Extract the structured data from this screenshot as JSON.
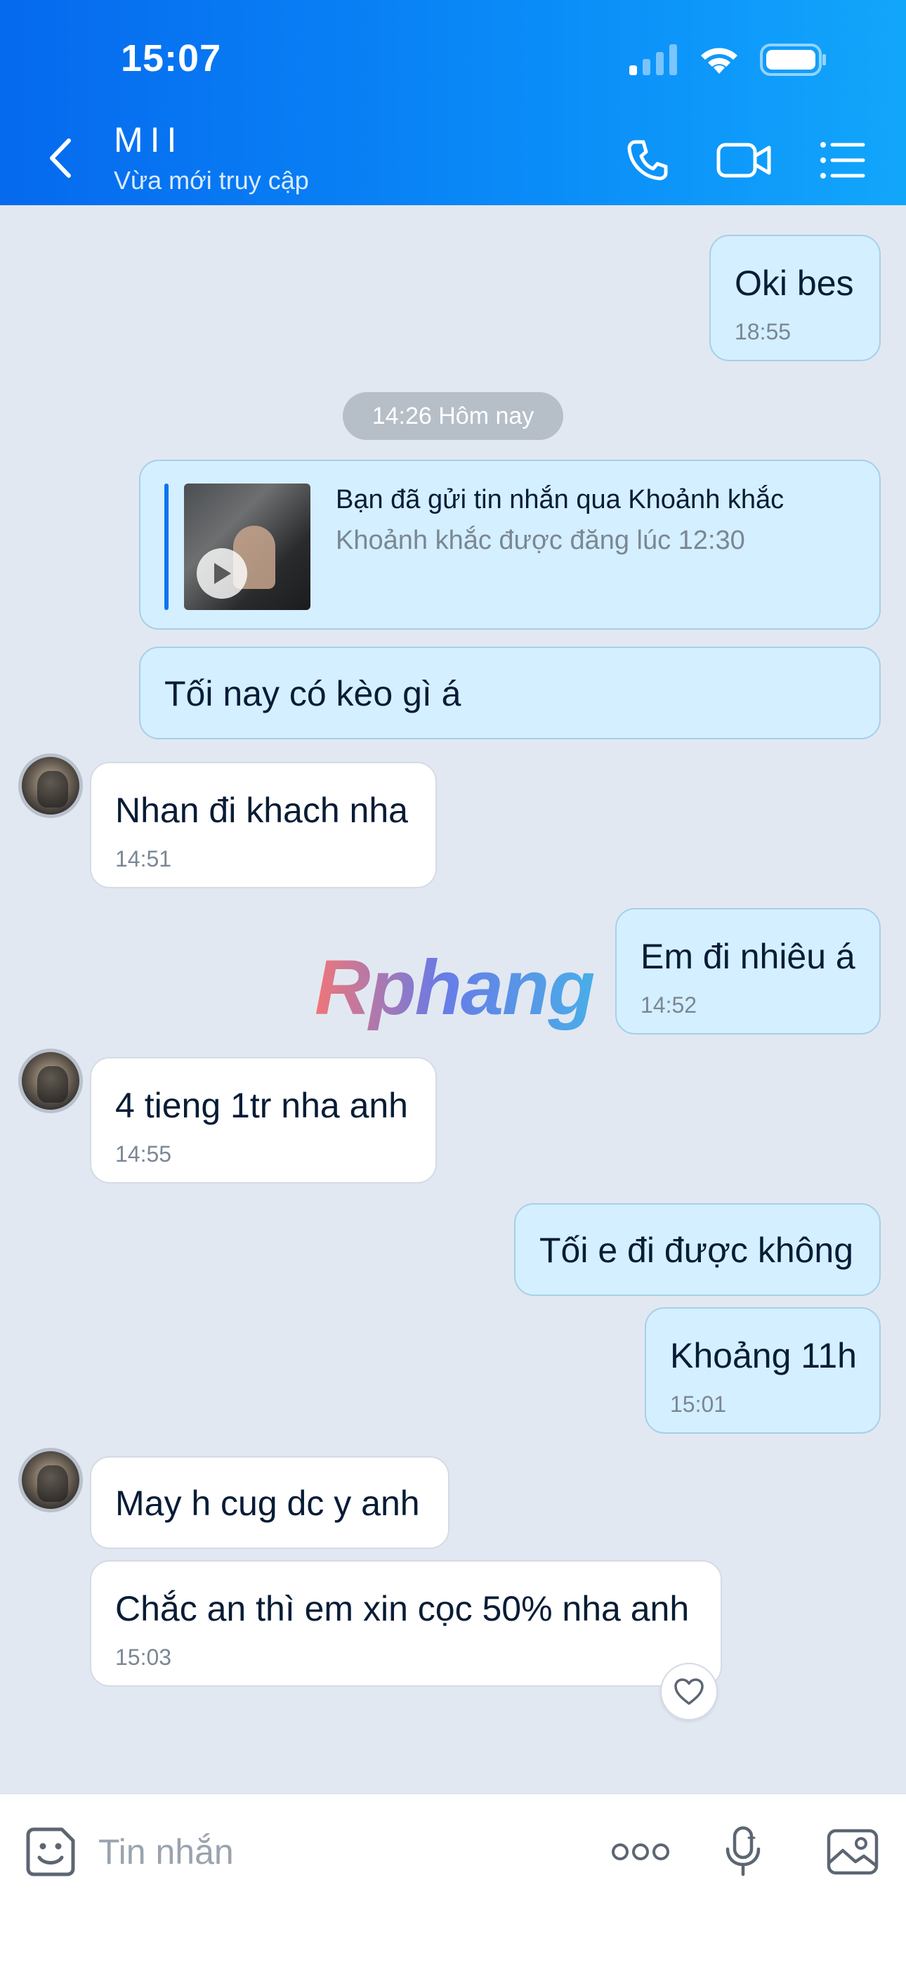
{
  "status_bar": {
    "time": "15:07"
  },
  "header": {
    "contact_name": "MII",
    "contact_status": "Vừa mới truy cập"
  },
  "date_separator": "14:26 Hôm nay",
  "moment": {
    "title": "Bạn đã gửi tin nhắn qua Khoảnh khắc",
    "subtitle": "Khoảnh khắc được đăng lúc 12:30"
  },
  "messages": [
    {
      "direction": "out",
      "text": "Oki bes",
      "time": "18:55"
    },
    {
      "direction": "out",
      "text": "Tối nay có kèo gì á",
      "time": ""
    },
    {
      "direction": "in",
      "text": "Nhan đi khach nha",
      "time": "14:51"
    },
    {
      "direction": "out",
      "text": "Em đi nhiêu á",
      "time": "14:52"
    },
    {
      "direction": "in",
      "text": "4 tieng 1tr nha anh",
      "time": "14:55"
    },
    {
      "direction": "out",
      "text": "Tối e đi được không",
      "time": ""
    },
    {
      "direction": "out",
      "text": "Khoảng 11h",
      "time": "15:01"
    },
    {
      "direction": "in",
      "text": "May h cug dc y anh",
      "time": ""
    },
    {
      "direction": "in",
      "text": "Chắc an thì em xin cọc 50% nha anh",
      "time": "15:03"
    }
  ],
  "watermark": "Rphang",
  "input": {
    "placeholder": "Tin nhắn"
  },
  "colors": {
    "header_start": "#0669ee",
    "header_end": "#12a6fb",
    "outgoing_bubble": "#d4efff",
    "incoming_bubble": "#ffffff",
    "chat_background": "#e2e8f1"
  }
}
